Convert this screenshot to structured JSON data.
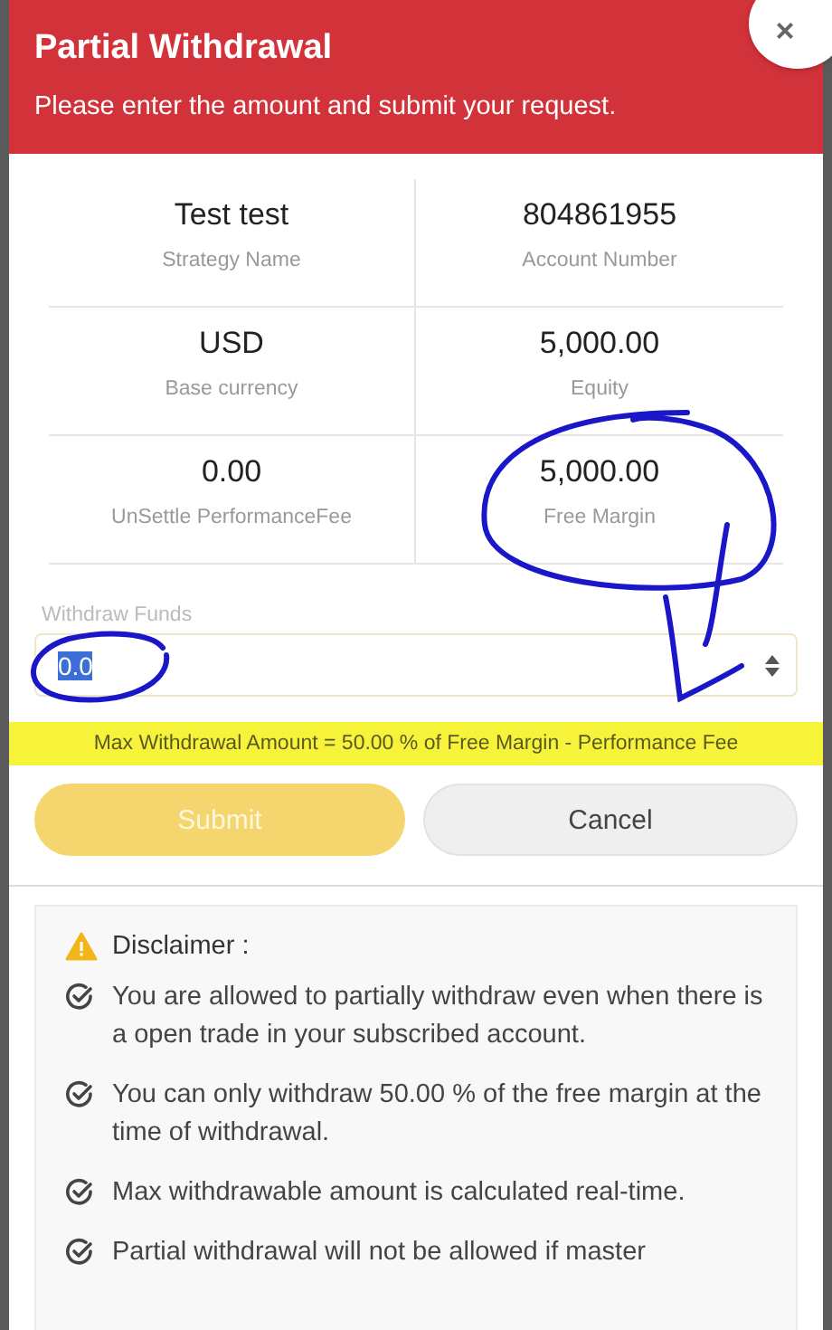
{
  "dialog": {
    "title": "Partial Withdrawal",
    "subtitle": "Please enter the amount and submit your request.",
    "close": "×"
  },
  "info": [
    {
      "value": "Test test",
      "label": "Strategy Name"
    },
    {
      "value": "804861955",
      "label": "Account Number"
    },
    {
      "value": "USD",
      "label": "Base currency"
    },
    {
      "value": "5,000.00",
      "label": "Equity"
    },
    {
      "value": "0.00",
      "label": "UnSettle PerformanceFee"
    },
    {
      "value": "5,000.00",
      "label": "Free Margin"
    }
  ],
  "withdraw_field": {
    "label": "Withdraw Funds",
    "value": "0.0",
    "selected": true
  },
  "note": "Max Withdrawal Amount = 50.00 % of Free Margin - Performance Fee",
  "buttons": [
    {
      "kind": "primary",
      "label": "Submit",
      "disabled": true
    },
    {
      "kind": "secondary",
      "label": "Cancel",
      "disabled": false
    }
  ],
  "disclaimer": {
    "title": "Disclaimer :",
    "items": [
      "You are allowed to partially withdraw even when there is a open trade in your subscribed account.",
      "You can only withdraw 50.00 % of the free margin at the time of withdrawal.",
      "Max withdrawable amount is calculated real-time.",
      "Partial withdrawal will not be allowed if master"
    ]
  }
}
